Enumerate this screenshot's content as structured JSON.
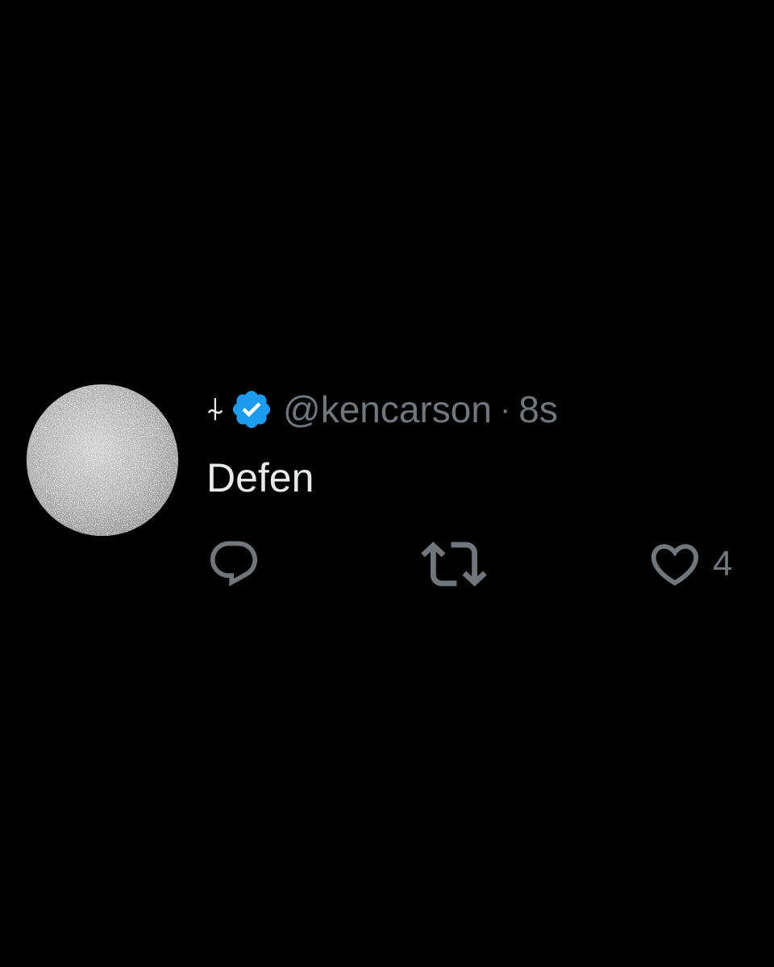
{
  "tweet": {
    "display_name": "⍭",
    "handle": "@kencarson",
    "separator": "·",
    "time": "8s",
    "text": "Defen",
    "like_count": "4"
  },
  "icons": {
    "verified": "verified-badge-icon",
    "reply": "reply-icon",
    "retweet": "retweet-icon",
    "like": "heart-icon"
  },
  "colors": {
    "background": "#000000",
    "primary_text": "#e7e9ea",
    "secondary_text": "#71767b",
    "verified_blue": "#1d9bf0"
  }
}
